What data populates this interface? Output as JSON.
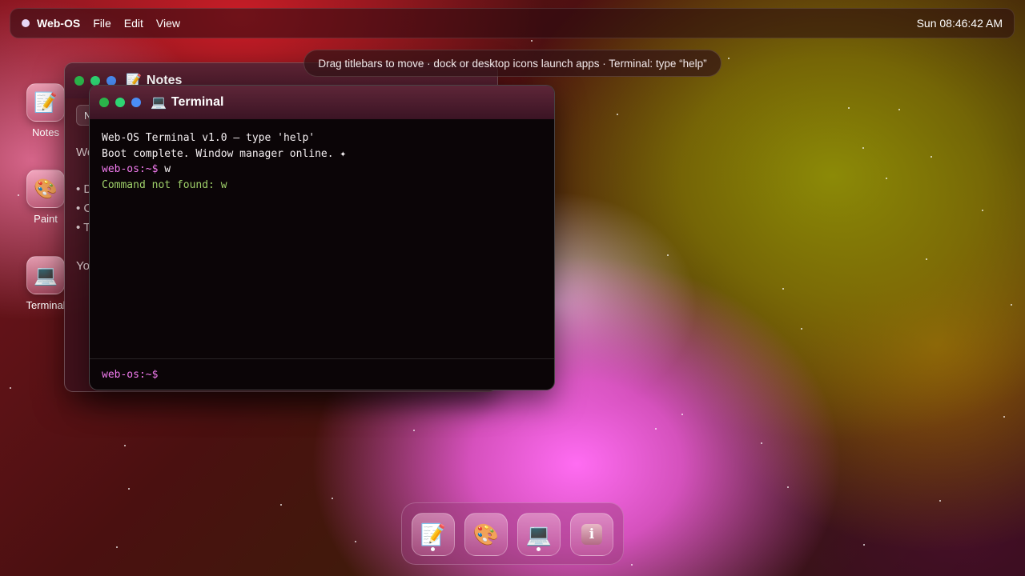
{
  "menubar": {
    "brand": "Web-OS",
    "menus": [
      "File",
      "Edit",
      "View"
    ],
    "clock": "Sun 08:46:42 AM"
  },
  "hint": "Drag titlebars to move · dock or desktop icons launch apps · Terminal: type “help”",
  "desktop_icons": [
    {
      "label": "Notes",
      "icon": "📝",
      "icon_name": "notes-icon"
    },
    {
      "label": "Paint",
      "icon": "🎨",
      "icon_name": "paint-palette-icon"
    },
    {
      "label": "Terminal",
      "icon": "💻",
      "icon_name": "laptop-icon"
    }
  ],
  "notes_window": {
    "title": "Notes",
    "icon": "📝",
    "toolbar_button": "N",
    "visible_fragments": [
      "We",
      "• D",
      "• C",
      "• T",
      "Yo"
    ]
  },
  "terminal_window": {
    "title": "Terminal",
    "icon": "💻",
    "lines": [
      {
        "type": "text",
        "text": "Web-OS Terminal v1.0 — type 'help'"
      },
      {
        "type": "text",
        "text": "Boot complete. Window manager online. ✦"
      },
      {
        "type": "prompt",
        "prompt": "web-os:~$",
        "command": "w"
      },
      {
        "type": "error",
        "text": "Command not found: w"
      }
    ],
    "input_prompt": "web-os:~$",
    "input_value": ""
  },
  "dock": {
    "items": [
      {
        "name": "Notes",
        "icon": "📝",
        "running": true
      },
      {
        "name": "Paint",
        "icon": "🎨",
        "running": false
      },
      {
        "name": "Terminal",
        "icon": "💻",
        "running": true
      },
      {
        "name": "Info",
        "icon": "i",
        "running": false
      }
    ]
  },
  "colors": {
    "prompt": "#f37cf0",
    "error": "#9fd06a",
    "traffic_green": "#2bb44a",
    "traffic_green2": "#2ed573",
    "traffic_blue": "#4a8df5"
  }
}
